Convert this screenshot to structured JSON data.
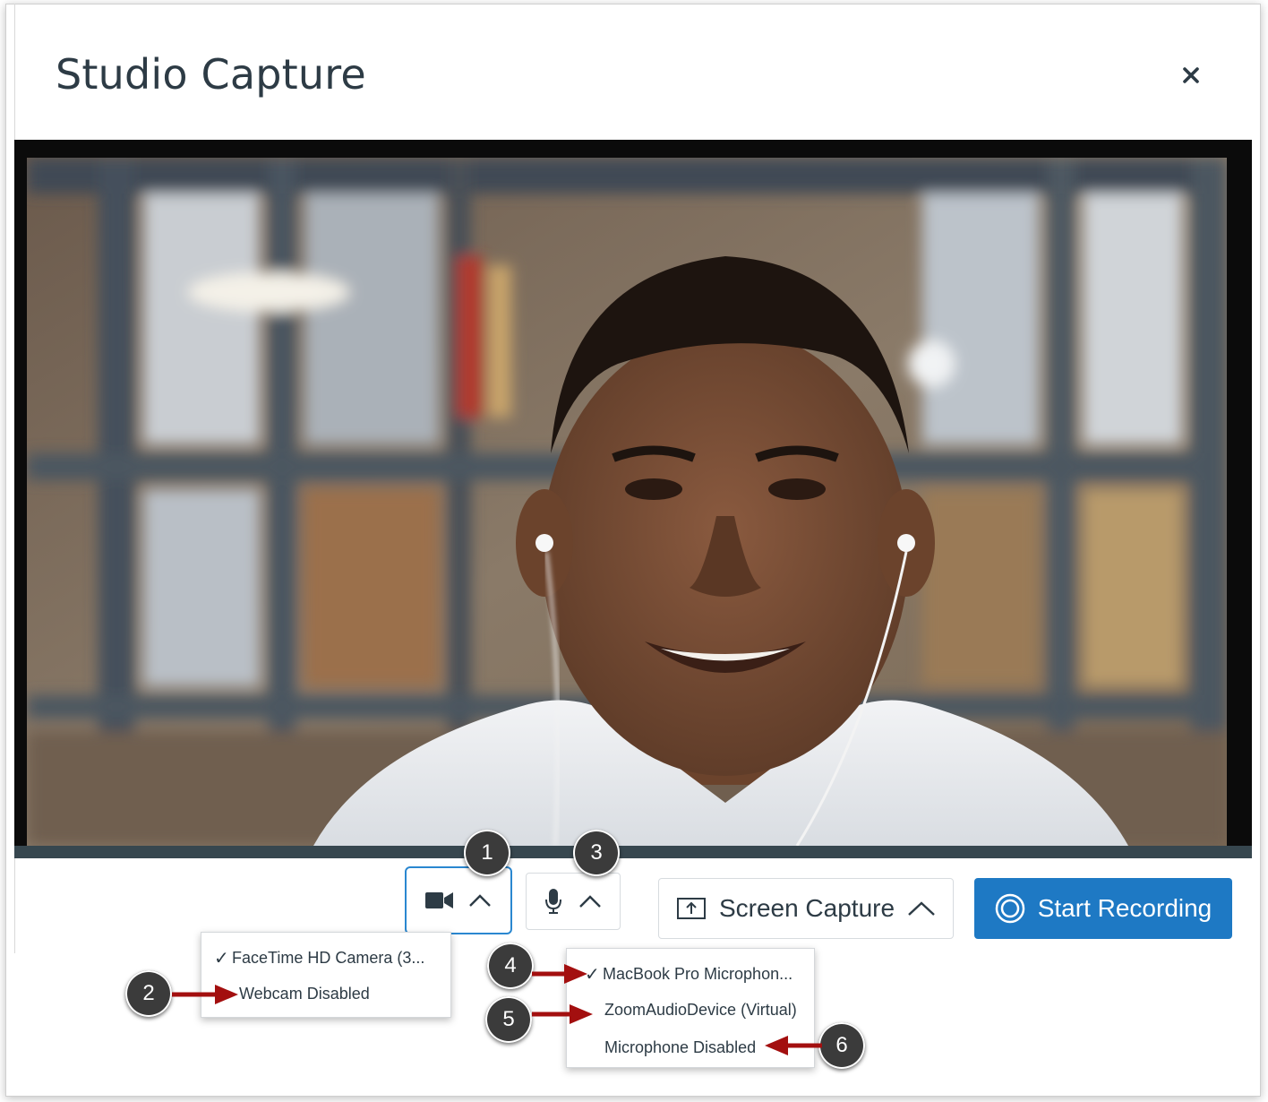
{
  "dialog": {
    "title": "Studio Capture",
    "close_label": "×"
  },
  "controls": {
    "screen_capture_label": "Screen Capture",
    "start_recording_label": "Start Recording"
  },
  "camera_menu": {
    "items": [
      {
        "label": "FaceTime HD Camera (3...",
        "selected": true
      },
      {
        "label": "Webcam Disabled",
        "selected": false
      }
    ]
  },
  "microphone_menu": {
    "items": [
      {
        "label": "MacBook Pro Microphon...",
        "selected": true
      },
      {
        "label": "ZoomAudioDevice (Virtual)",
        "selected": false
      },
      {
        "label": "Microphone Disabled",
        "selected": false
      }
    ]
  },
  "callouts": [
    "1",
    "2",
    "3",
    "4",
    "5",
    "6"
  ],
  "colors": {
    "accent": "#1e79c4",
    "focus_outline": "#2a87d0",
    "arrow": "#a30f0f",
    "callout_bg": "#3b3b3b"
  }
}
